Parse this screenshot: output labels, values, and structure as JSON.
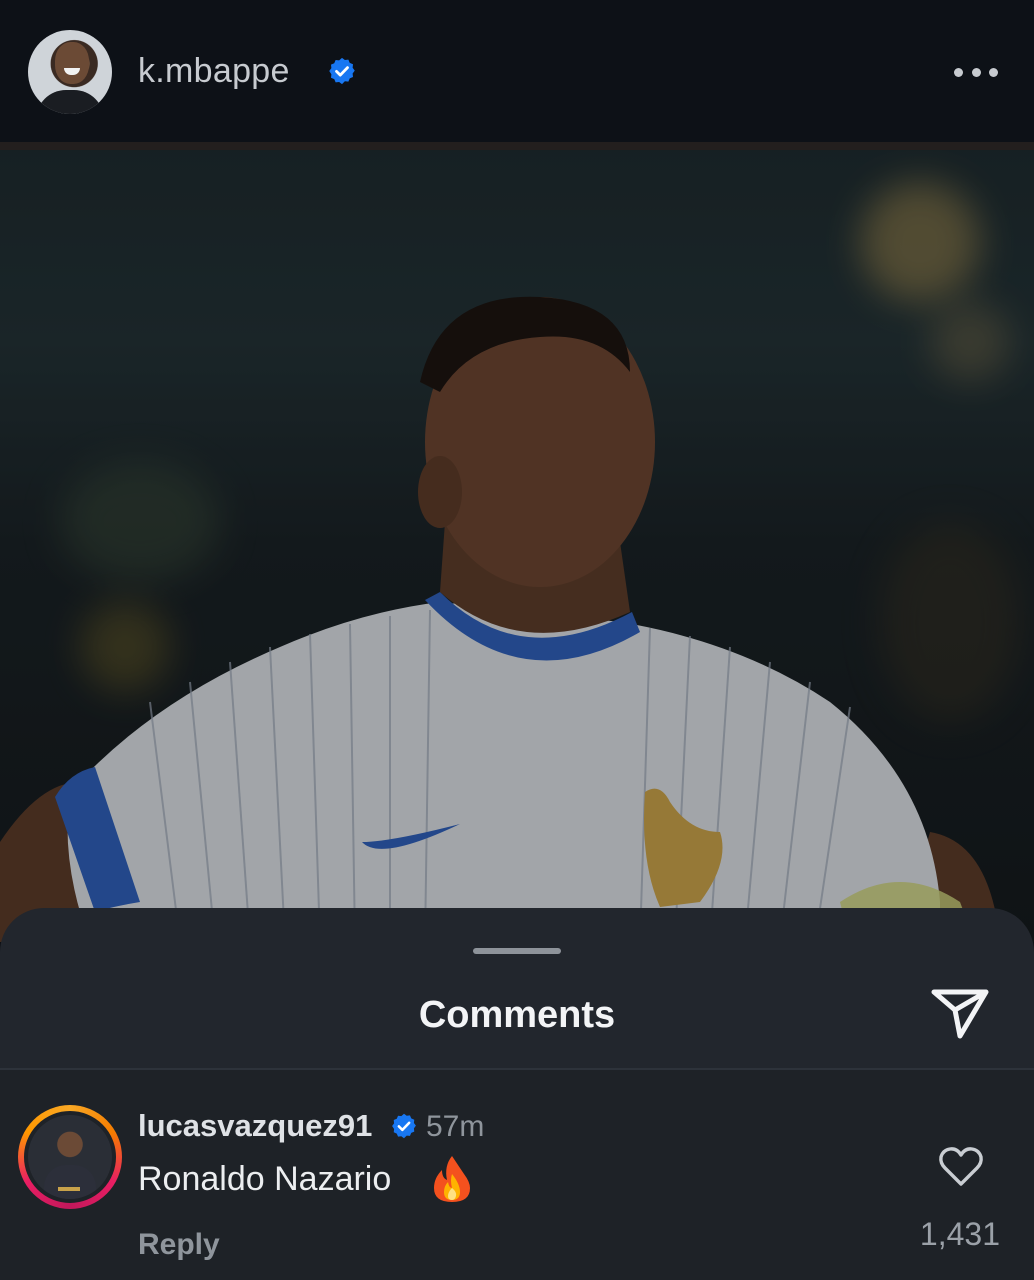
{
  "header": {
    "username": "k.mbappe",
    "avatar_icon": "profile-photo",
    "verified_icon": "verified-badge-icon",
    "more_icon": "more-horizontal-icon"
  },
  "post": {
    "image_icon": "post-photo"
  },
  "comments_sheet": {
    "title": "Comments",
    "share_icon": "send-icon"
  },
  "comments": [
    {
      "username": "lucasvazquez91",
      "time": "57m",
      "text": "Ronaldo Nazario",
      "emoji_icon": "fire-emoji-icon",
      "reply_label": "Reply",
      "likes": "1,431",
      "like_icon": "heart-outline-icon"
    }
  ],
  "colors": {
    "background": "#0d1117",
    "sheet": "#22262d",
    "verified": "#1877f2",
    "muted_text": "#8f959c"
  }
}
